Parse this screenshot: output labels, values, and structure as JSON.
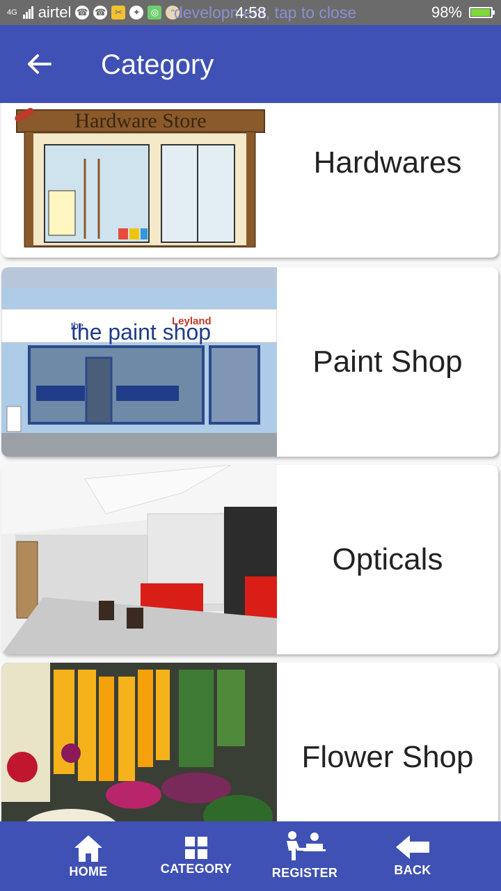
{
  "status_bar": {
    "network": "4G",
    "carrier": "airtel",
    "notice": "development, tap to close",
    "time": "4:58",
    "battery": "98%",
    "battery_level": 0.98
  },
  "app_bar": {
    "title": "Category",
    "back_icon": "arrow-left-icon"
  },
  "categories": [
    {
      "label": "Hardwares",
      "image_text": "Hardware Store"
    },
    {
      "label": "Paint Shop",
      "image_text": "the paint shop",
      "image_brand": "Leyland"
    },
    {
      "label": "Opticals"
    },
    {
      "label": "Flower Shop"
    }
  ],
  "bottom_nav": [
    {
      "label": "HOME",
      "icon": "home-icon"
    },
    {
      "label": "CATEGORY",
      "icon": "category-grid-icon"
    },
    {
      "label": "REGISTER",
      "icon": "register-people-icon"
    },
    {
      "label": "BACK",
      "icon": "back-arrow-icon"
    }
  ],
  "colors": {
    "primary": "#3f51b5",
    "status_bar": "#6b6b6b"
  }
}
